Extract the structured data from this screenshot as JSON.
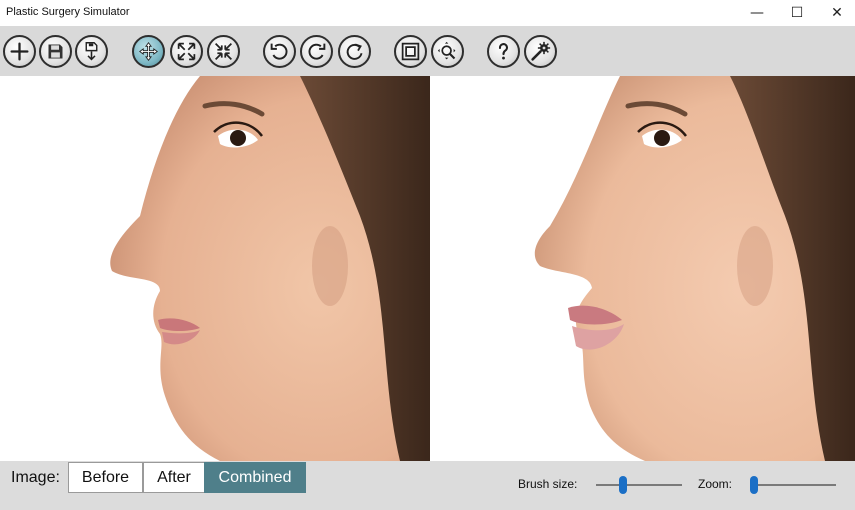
{
  "window": {
    "title": "Plastic Surgery Simulator",
    "minimize_glyph": "—",
    "maximize_glyph": "☐",
    "close_glyph": "✕"
  },
  "toolbar": {
    "buttons": [
      {
        "name": "new-icon",
        "active": false
      },
      {
        "name": "save-icon",
        "active": false
      },
      {
        "name": "export-icon",
        "active": false
      },
      {
        "name": "move-icon",
        "active": true
      },
      {
        "name": "enlarge-icon",
        "active": false
      },
      {
        "name": "shrink-icon",
        "active": false
      },
      {
        "name": "rotate-left-icon",
        "active": false
      },
      {
        "name": "rotate-right-icon",
        "active": false
      },
      {
        "name": "reset-icon",
        "active": false
      },
      {
        "name": "fit-icon",
        "active": false
      },
      {
        "name": "zoom-icon",
        "active": false
      },
      {
        "name": "help-icon",
        "active": false
      },
      {
        "name": "settings-icon",
        "active": false
      }
    ]
  },
  "panels": {
    "before": {
      "skin": "#e9b89a",
      "nose_shape": "large-hooked"
    },
    "after": {
      "skin": "#ecc0a2",
      "nose_shape": "refined"
    }
  },
  "bottom": {
    "image_label": "Image:",
    "view_modes": [
      "Before",
      "After",
      "Combined"
    ],
    "selected_mode": "Combined",
    "brush_label": "Brush size:",
    "brush_value": 0.3,
    "zoom_label": "Zoom:",
    "zoom_value": 0.0
  },
  "colors": {
    "accent": "#4f7f8a",
    "slider_thumb": "#1b6fc6",
    "toolbar_bg": "#d9d9d9"
  }
}
